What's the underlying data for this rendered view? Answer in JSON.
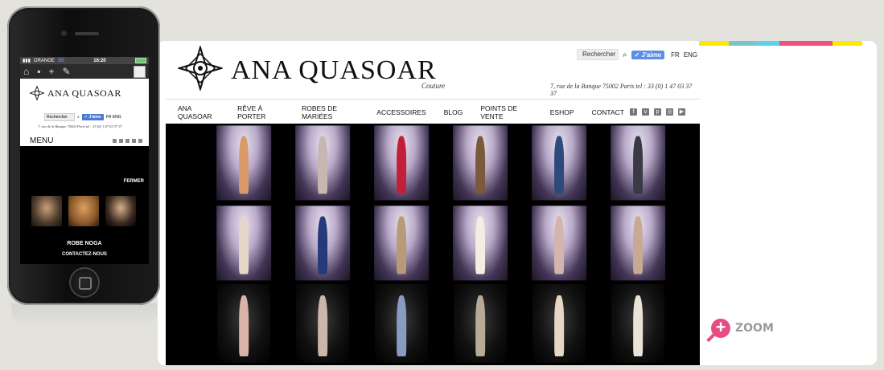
{
  "brand": {
    "name": "ANA QUASOAR",
    "couture": "Couture"
  },
  "header": {
    "search_placeholder": "Rechercher",
    "like_label": "J'aime",
    "lang_fr": "FR",
    "lang_eng": "ENG",
    "address": "7, rue de la Banque 75002 Paris tel : 33 (0) 1 47 03 37 37"
  },
  "nav": {
    "items": [
      "ANA QUASOAR",
      "RÊVE À PORTER",
      "ROBES DE MARIÉES",
      "ACCESSOIRES",
      "BLOG",
      "POINTS DE VENTE",
      "ESHOP",
      "CONTACT"
    ]
  },
  "social_icons": [
    "facebook-icon",
    "vimeo-icon",
    "pinterest-icon",
    "instagram-icon",
    "youtube-icon"
  ],
  "colorbar": [
    "#ffe800",
    "#7cc3cc",
    "#5ad4ec",
    "#f0507a",
    "#f0507a",
    "#ffe800"
  ],
  "mobile": {
    "carrier": "ORANGE",
    "network": "3G",
    "time": "16:20",
    "brand": "ANA QUASOAR",
    "search_placeholder": "Rechercher",
    "like_label": "J'aime",
    "lang": "FR ENG",
    "address": "7, rue de la Banque 75002 Paris tel : 33 (0) 1 47 03 37 37",
    "menu_label": "MENU",
    "close_label": "FERMER",
    "product_title": "ROBE NOGA",
    "contact_label": "CONTACTEZ-NOUS"
  },
  "zoom": {
    "label": "ZOOM",
    "color": "#e94c84"
  },
  "gallery_dresses": [
    "#d99a6a",
    "#c8b6b0",
    "#c0203a",
    "#7a5a3a",
    "#2c4a7a",
    "#3a3a44",
    "#e7d6c8",
    "#263a7a",
    "#b89a78",
    "#f2eee2",
    "#d6b4ae",
    "#c9a894",
    "#d8b3a6",
    "#ccb5aa",
    "#8a9bc2",
    "#b7ab98",
    "#e6d7c4",
    "#ece3d8"
  ]
}
